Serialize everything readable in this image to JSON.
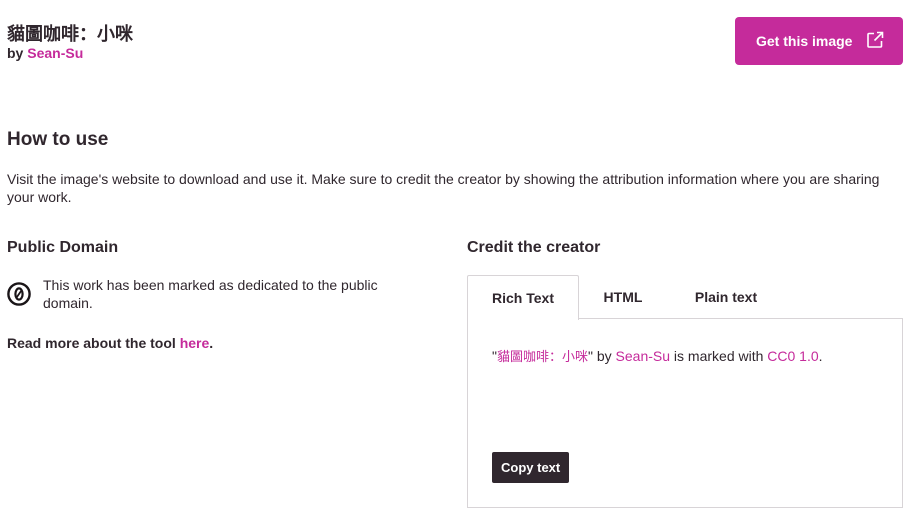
{
  "header": {
    "title": "貓圖咖啡：小咪",
    "by_prefix": "by",
    "creator": "Sean-Su",
    "get_image_label": "Get this image"
  },
  "how_to_use": {
    "heading": "How to use",
    "text": "Visit the image's website to download and use it. Make sure to credit the creator by showing the attribution information where you are sharing your work."
  },
  "license": {
    "heading": "Public Domain",
    "description": "This work has been marked as dedicated to the public domain.",
    "read_more_prefix": "Read more about the tool",
    "read_more_link": "here",
    "read_more_suffix": "."
  },
  "credit": {
    "heading": "Credit the creator",
    "tabs": [
      {
        "label": "Rich Text",
        "active": true
      },
      {
        "label": "HTML",
        "active": false
      },
      {
        "label": "Plain text",
        "active": false
      }
    ],
    "attribution": {
      "open_quote": "\"",
      "title": "貓圖咖啡：小咪",
      "close_quote_by": "\" by ",
      "creator": "Sean-Su",
      "marked_with": " is marked with ",
      "license": "CC0 1.0",
      "end": "."
    },
    "copy_label": "Copy text"
  },
  "colors": {
    "accent": "#c52b9b",
    "text": "#30272e",
    "border": "#d8d4d7"
  },
  "icons": {
    "external_link": "external-link-icon",
    "cc0": "cc0-icon"
  }
}
